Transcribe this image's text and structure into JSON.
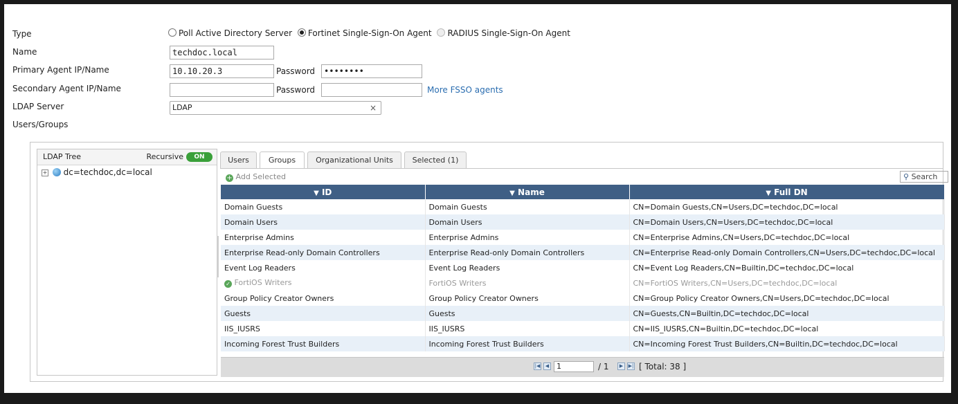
{
  "form": {
    "type_label": "Type",
    "type_options": [
      "Poll Active Directory Server",
      "Fortinet Single-Sign-On Agent",
      "RADIUS Single-Sign-On Agent"
    ],
    "type_selected": "Fortinet Single-Sign-On Agent",
    "name_label": "Name",
    "name_value": "techdoc.local",
    "primary_label": "Primary Agent IP/Name",
    "primary_value": "10.10.20.3",
    "password_label": "Password",
    "primary_password": "••••••••",
    "secondary_label": "Secondary Agent IP/Name",
    "secondary_value": "",
    "secondary_password": "",
    "more_link": "More FSSO agents",
    "ldap_label": "LDAP Server",
    "ldap_value": "LDAP",
    "users_groups_label": "Users/Groups"
  },
  "tree": {
    "title": "LDAP Tree",
    "recursive_label": "Recursive",
    "toggle_text": "ON",
    "node": "dc=techdoc,dc=local"
  },
  "tabs": [
    "Users",
    "Groups",
    "Organizational Units",
    "Selected (1)"
  ],
  "active_tab": "Groups",
  "toolbar": {
    "add_selected": "Add Selected",
    "search": "Search"
  },
  "table": {
    "headers": [
      "ID",
      "Name",
      "Full DN"
    ],
    "rows": [
      [
        "Domain Guests",
        "Domain Guests",
        "CN=Domain Guests,CN=Users,DC=techdoc,DC=local"
      ],
      [
        "Domain Users",
        "Domain Users",
        "CN=Domain Users,CN=Users,DC=techdoc,DC=local"
      ],
      [
        "Enterprise Admins",
        "Enterprise Admins",
        "CN=Enterprise Admins,CN=Users,DC=techdoc,DC=local"
      ],
      [
        "Enterprise Read-only Domain Controllers",
        "Enterprise Read-only Domain Controllers",
        "CN=Enterprise Read-only Domain Controllers,CN=Users,DC=techdoc,DC=local"
      ],
      [
        "Event Log Readers",
        "Event Log Readers",
        "CN=Event Log Readers,CN=Builtin,DC=techdoc,DC=local"
      ],
      [
        "FortiOS Writers",
        "FortiOS Writers",
        "CN=FortiOS Writers,CN=Users,DC=techdoc,DC=local"
      ],
      [
        "Group Policy Creator Owners",
        "Group Policy Creator Owners",
        "CN=Group Policy Creator Owners,CN=Users,DC=techdoc,DC=local"
      ],
      [
        "Guests",
        "Guests",
        "CN=Guests,CN=Builtin,DC=techdoc,DC=local"
      ],
      [
        "IIS_IUSRS",
        "IIS_IUSRS",
        "CN=IIS_IUSRS,CN=Builtin,DC=techdoc,DC=local"
      ],
      [
        "Incoming Forest Trust Builders",
        "Incoming Forest Trust Builders",
        "CN=Incoming Forest Trust Builders,CN=Builtin,DC=techdoc,DC=local"
      ]
    ]
  },
  "pager": {
    "page": "1",
    "of": "/ 1",
    "total": "[ Total: 38 ]"
  },
  "colors": {
    "header": "#3f5f85",
    "alt_row": "#e8f0f8",
    "toggle": "#3aa03a",
    "link": "#2a6db0"
  }
}
